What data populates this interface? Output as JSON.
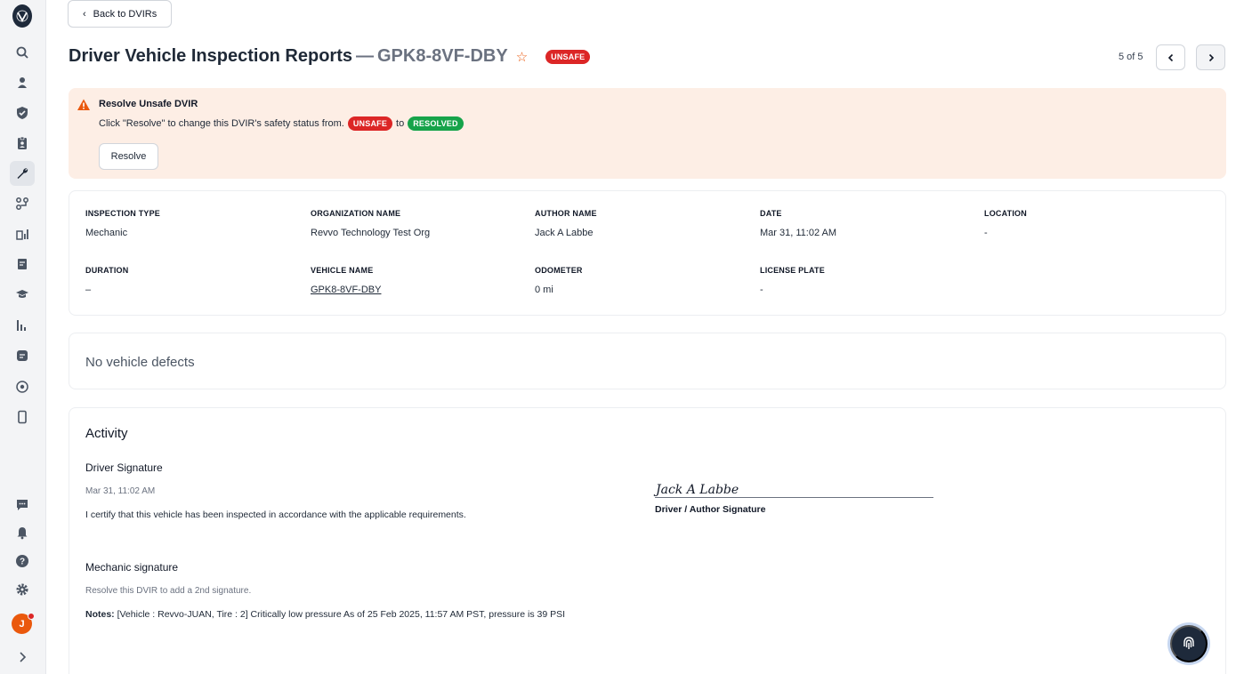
{
  "sidebar": {
    "logo": "revvo-logo-icon",
    "items": [
      {
        "icon": "search-icon"
      },
      {
        "icon": "driver-location-icon"
      },
      {
        "icon": "shield-check-icon"
      },
      {
        "icon": "clipboard-user-icon"
      },
      {
        "icon": "wrench-icon",
        "active": true
      },
      {
        "icon": "route-icon"
      },
      {
        "icon": "fuel-stats-icon"
      },
      {
        "icon": "document-edit-icon"
      },
      {
        "icon": "graduation-cap-icon"
      },
      {
        "icon": "bar-chart-icon"
      },
      {
        "icon": "tag-icon"
      },
      {
        "icon": "target-icon"
      },
      {
        "icon": "mobile-icon"
      }
    ],
    "bottom_items": [
      {
        "icon": "chat-icon"
      },
      {
        "icon": "bell-icon"
      },
      {
        "icon": "help-icon"
      },
      {
        "icon": "gear-icon"
      }
    ],
    "avatar_initial": "J",
    "expand_icon": "chevron-right-icon"
  },
  "back_button": {
    "label": "Back to DVIRs"
  },
  "header": {
    "title": "Driver Vehicle Inspection Reports",
    "separator": "—",
    "vehicle_id": "GPK8-8VF-DBY",
    "status_badge": "UNSAFE",
    "pager_text": "5 of 5"
  },
  "alert": {
    "title": "Resolve Unsafe DVIR",
    "text_before": "Click \"Resolve\" to change this DVIR's safety status from.",
    "from_badge": "UNSAFE",
    "connector": "to",
    "to_badge": "RESOLVED",
    "button_label": "Resolve"
  },
  "details": {
    "inspection_type": {
      "label": "INSPECTION TYPE",
      "value": "Mechanic"
    },
    "organization_name": {
      "label": "ORGANIZATION NAME",
      "value": "Revvo Technology Test Org"
    },
    "author_name": {
      "label": "AUTHOR NAME",
      "value": "Jack A Labbe"
    },
    "date": {
      "label": "DATE",
      "value": "Mar 31, 11:02 AM"
    },
    "location": {
      "label": "LOCATION",
      "value": "-"
    },
    "duration": {
      "label": "DURATION",
      "value": "–"
    },
    "vehicle_name": {
      "label": "VEHICLE NAME",
      "value": "GPK8-8VF-DBY"
    },
    "odometer": {
      "label": "ODOMETER",
      "value": "0 mi"
    },
    "license_plate": {
      "label": "LICENSE PLATE",
      "value": "-"
    }
  },
  "defects": {
    "text": "No vehicle defects"
  },
  "activity": {
    "title": "Activity",
    "driver_signature": {
      "title": "Driver Signature",
      "timestamp": "Mar 31, 11:02 AM",
      "statement": "I certify that this vehicle has been inspected in accordance with the applicable requirements.",
      "signature_name": "Jack A Labbe",
      "signature_caption": "Driver / Author Signature"
    },
    "mechanic_signature": {
      "title": "Mechanic signature",
      "hint": "Resolve this DVIR to add a 2nd signature.",
      "notes_label": "Notes:",
      "notes_text": "[Vehicle : Revvo-JUAN, Tire : 2] Critically low pressure As of 25 Feb 2025, 11:57 AM PST, pressure is 39 PSI"
    }
  },
  "fab": {
    "icon": "fingerprint-icon"
  },
  "colors": {
    "unsafe": "#dc2626",
    "resolved": "#16a34a",
    "alert_bg": "#fdeee5",
    "accent": "#ea580c",
    "sidebar_bg": "#f3f4f6"
  }
}
